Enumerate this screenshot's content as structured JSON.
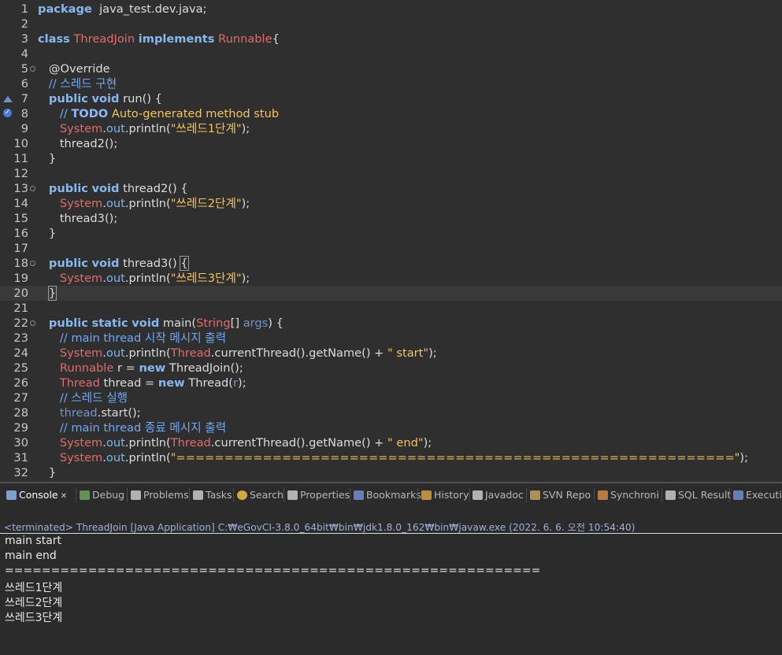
{
  "editor": {
    "lines": [
      {
        "n": "1",
        "code": [
          [
            "kwb",
            "package"
          ],
          [
            "",
            "  java_test.dev.java;"
          ]
        ]
      },
      {
        "n": "2",
        "code": []
      },
      {
        "n": "3",
        "code": [
          [
            "kwb",
            "class"
          ],
          [
            "",
            " "
          ],
          [
            "cls",
            "ThreadJoin"
          ],
          [
            "",
            " "
          ],
          [
            "kwb",
            "implements"
          ],
          [
            "",
            " "
          ],
          [
            "cls",
            "Runnable"
          ],
          [
            "",
            "{"
          ]
        ]
      },
      {
        "n": "4",
        "code": []
      },
      {
        "n": "5",
        "fold": true,
        "code": [
          [
            "",
            "   "
          ],
          [
            "ann",
            "@Override"
          ]
        ]
      },
      {
        "n": "6",
        "code": [
          [
            "",
            "   "
          ],
          [
            "com",
            "// 스레드 구현"
          ]
        ]
      },
      {
        "n": "7",
        "marker": "override",
        "code": [
          [
            "",
            "   "
          ],
          [
            "kwb",
            "public"
          ],
          [
            "",
            " "
          ],
          [
            "kwb",
            "void"
          ],
          [
            "",
            " run() {"
          ]
        ]
      },
      {
        "n": "8",
        "marker": "task",
        "code": [
          [
            "",
            "      "
          ],
          [
            "com",
            "// "
          ],
          [
            "todo",
            "TODO"
          ],
          [
            "str",
            " Auto-generated method stub"
          ]
        ]
      },
      {
        "n": "9",
        "code": [
          [
            "",
            "      "
          ],
          [
            "cls",
            "System"
          ],
          [
            "",
            "."
          ],
          [
            "fld",
            "out"
          ],
          [
            "",
            ".println("
          ],
          [
            "str",
            "\"쓰레드1단계\""
          ],
          [
            "",
            ");"
          ]
        ]
      },
      {
        "n": "10",
        "code": [
          [
            "",
            "      thread2();"
          ]
        ]
      },
      {
        "n": "11",
        "code": [
          [
            "",
            "   }"
          ]
        ]
      },
      {
        "n": "12",
        "code": []
      },
      {
        "n": "13",
        "fold": true,
        "code": [
          [
            "",
            "   "
          ],
          [
            "kwb",
            "public"
          ],
          [
            "",
            " "
          ],
          [
            "kwb",
            "void"
          ],
          [
            "",
            " thread2() {"
          ]
        ]
      },
      {
        "n": "14",
        "code": [
          [
            "",
            "      "
          ],
          [
            "cls",
            "System"
          ],
          [
            "",
            "."
          ],
          [
            "fld",
            "out"
          ],
          [
            "",
            ".println("
          ],
          [
            "str",
            "\"쓰레드2단계\""
          ],
          [
            "",
            ");"
          ]
        ]
      },
      {
        "n": "15",
        "code": [
          [
            "",
            "      thread3();"
          ]
        ]
      },
      {
        "n": "16",
        "code": [
          [
            "",
            "   }"
          ]
        ]
      },
      {
        "n": "17",
        "code": []
      },
      {
        "n": "18",
        "fold": true,
        "code": [
          [
            "",
            "   "
          ],
          [
            "kwb",
            "public"
          ],
          [
            "",
            " "
          ],
          [
            "kwb",
            "void"
          ],
          [
            "",
            " thread3() "
          ],
          [
            "box",
            "{"
          ]
        ]
      },
      {
        "n": "19",
        "code": [
          [
            "",
            "      "
          ],
          [
            "cls",
            "System"
          ],
          [
            "",
            "."
          ],
          [
            "fld",
            "out"
          ],
          [
            "",
            ".println("
          ],
          [
            "str",
            "\"쓰레드3단계\""
          ],
          [
            "",
            ");"
          ]
        ]
      },
      {
        "n": "20",
        "current": true,
        "code": [
          [
            "",
            "   "
          ],
          [
            "box",
            "}"
          ],
          [
            "caret",
            ""
          ]
        ]
      },
      {
        "n": "21",
        "code": []
      },
      {
        "n": "22",
        "fold": true,
        "code": [
          [
            "",
            "   "
          ],
          [
            "kwb",
            "public"
          ],
          [
            "",
            " "
          ],
          [
            "kwb",
            "static"
          ],
          [
            "",
            " "
          ],
          [
            "kwb",
            "void"
          ],
          [
            "",
            " main("
          ],
          [
            "cls",
            "String"
          ],
          [
            "",
            "[] "
          ],
          [
            "var",
            "args"
          ],
          [
            "",
            ") {"
          ]
        ]
      },
      {
        "n": "23",
        "code": [
          [
            "",
            "      "
          ],
          [
            "com",
            "// main thread 시작 메시지 출력"
          ]
        ]
      },
      {
        "n": "24",
        "code": [
          [
            "",
            "      "
          ],
          [
            "cls",
            "System"
          ],
          [
            "",
            "."
          ],
          [
            "fld",
            "out"
          ],
          [
            "",
            ".println("
          ],
          [
            "cls",
            "Thread"
          ],
          [
            "",
            ".currentThread().getName() + "
          ],
          [
            "str",
            "\" start\""
          ],
          [
            "",
            ");"
          ]
        ]
      },
      {
        "n": "25",
        "code": [
          [
            "",
            "      "
          ],
          [
            "cls",
            "Runnable"
          ],
          [
            "",
            ""
          ],
          [
            "",
            " r = "
          ],
          [
            "kwb",
            "new"
          ],
          [
            "",
            " ThreadJoin();"
          ]
        ]
      },
      {
        "n": "26",
        "code": [
          [
            "",
            "      "
          ],
          [
            "cls",
            "Thread"
          ],
          [
            "",
            " thread = "
          ],
          [
            "kwb",
            "new"
          ],
          [
            "",
            " Thread("
          ],
          [
            "var",
            "r"
          ],
          [
            "",
            ");"
          ]
        ]
      },
      {
        "n": "27",
        "code": [
          [
            "",
            "      "
          ],
          [
            "com",
            "// 스레드 실행"
          ]
        ]
      },
      {
        "n": "28",
        "code": [
          [
            "",
            "      "
          ],
          [
            "var",
            "thread"
          ],
          [
            "",
            ".start();"
          ]
        ]
      },
      {
        "n": "29",
        "code": [
          [
            "",
            "      "
          ],
          [
            "com",
            "// main thread 종료 메시지 출력"
          ]
        ]
      },
      {
        "n": "30",
        "code": [
          [
            "",
            "      "
          ],
          [
            "cls",
            "System"
          ],
          [
            "",
            "."
          ],
          [
            "fld",
            "out"
          ],
          [
            "",
            ".println("
          ],
          [
            "cls",
            "Thread"
          ],
          [
            "",
            ".currentThread().getName() + "
          ],
          [
            "str",
            "\" end\""
          ],
          [
            "",
            ");"
          ]
        ]
      },
      {
        "n": "31",
        "code": [
          [
            "",
            "      "
          ],
          [
            "cls",
            "System"
          ],
          [
            "",
            "."
          ],
          [
            "fld",
            "out"
          ],
          [
            "",
            ".println("
          ],
          [
            "str",
            "\"==========================================================\""
          ],
          [
            "",
            ");"
          ]
        ]
      },
      {
        "n": "32",
        "code": [
          [
            "",
            "   }"
          ]
        ]
      }
    ]
  },
  "tabs": [
    {
      "label": "Console",
      "icon": "console-icon",
      "active": true,
      "close": "✕"
    },
    {
      "label": "Debug",
      "icon": "bug-icon"
    },
    {
      "label": "Problems",
      "icon": "problems-icon"
    },
    {
      "label": "Tasks",
      "icon": "tasks-icon"
    },
    {
      "label": "Search",
      "icon": "search-icon"
    },
    {
      "label": "Properties",
      "icon": "properties-icon"
    },
    {
      "label": "Bookmarks",
      "icon": "bookmark-icon"
    },
    {
      "label": "History",
      "icon": "history-icon"
    },
    {
      "label": "Javadoc",
      "icon": "javadoc-icon"
    },
    {
      "label": "SVN Repo",
      "icon": "svn-repo-icon"
    },
    {
      "label": "Synchroni",
      "icon": "synchronize-icon"
    },
    {
      "label": "SQL Result",
      "icon": "sql-result-icon"
    },
    {
      "label": "Executi",
      "icon": "execution-icon"
    }
  ],
  "console": {
    "terminated": "<terminated> ThreadJoin [Java Application] C:₩eGovCI-3.8.0_64bit₩bin₩jdk1.8.0_162₩bin₩javaw.exe (2022. 6. 6. 오전 10:54:40)",
    "output": [
      "main start",
      "main end",
      "==========================================================",
      "쓰레드1단계",
      "쓰레드2단계",
      "쓰레드3단계"
    ]
  },
  "colors": {
    "background": "#2f2f2f",
    "keyword": "#86b8f0",
    "class": "#e06c6c",
    "string": "#f2c45c",
    "comment": "#6fa8f5"
  }
}
